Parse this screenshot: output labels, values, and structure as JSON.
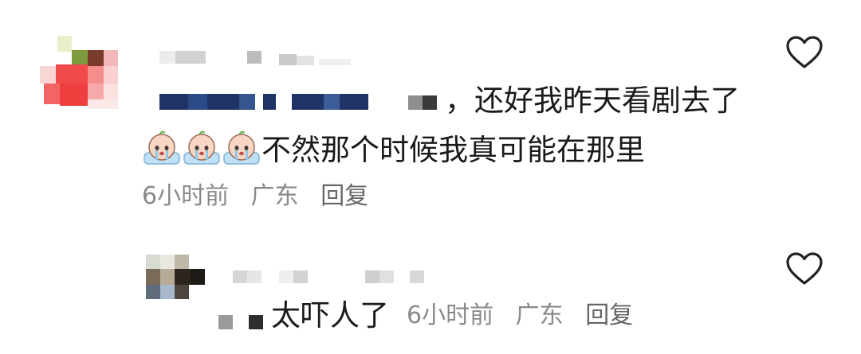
{
  "comments": [
    {
      "text_suffix": "，还好我昨天看剧去了",
      "text_line2": "不然那个时候我真可能在那里",
      "emoji_icon": "crying-face-emoji",
      "time": "6小时前",
      "location": "广东",
      "reply_label": "回复",
      "like_icon": "heart-icon"
    },
    {
      "text": "太吓人了",
      "time": "6小时前",
      "location": "广东",
      "reply_label": "回复",
      "like_icon": "heart-icon"
    }
  ]
}
